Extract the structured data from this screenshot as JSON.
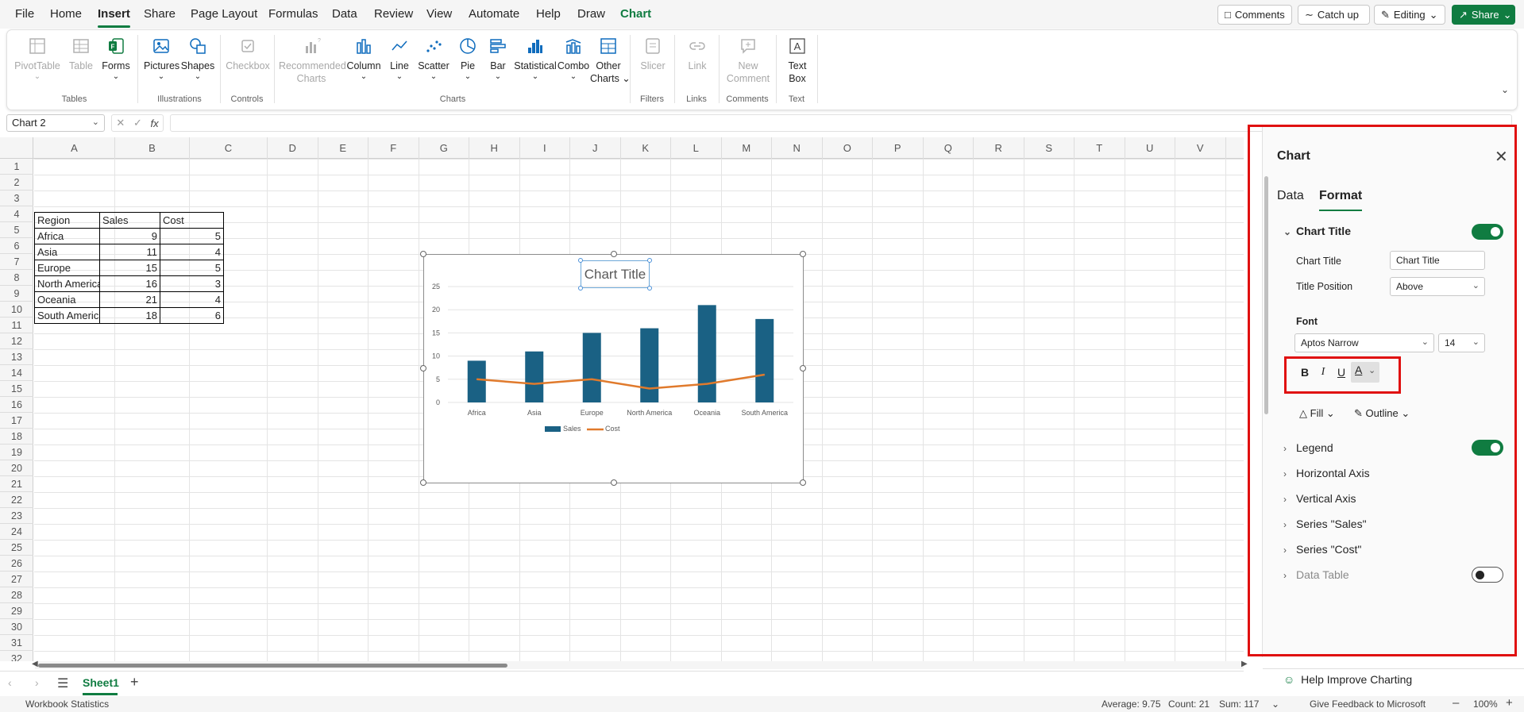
{
  "menu": {
    "tabs": [
      "File",
      "Home",
      "Insert",
      "Share",
      "Page Layout",
      "Formulas",
      "Data",
      "Review",
      "View",
      "Automate",
      "Help",
      "Draw",
      "Chart"
    ],
    "active": "Insert",
    "comments": "Comments",
    "catchup": "Catch up",
    "editing": "Editing",
    "share": "Share"
  },
  "ribbon": {
    "pivottable": "PivotTable",
    "table": "Table",
    "forms": "Forms",
    "pictures": "Pictures",
    "shapes": "Shapes",
    "checkbox": "Checkbox",
    "recommended": "Recommended",
    "charts_word": "Charts",
    "column": "Column",
    "line": "Line",
    "scatter": "Scatter",
    "pie": "Pie",
    "bar": "Bar",
    "statistical": "Statistical",
    "combo": "Combo",
    "other": "Other",
    "other2": "Charts",
    "slicer": "Slicer",
    "link": "Link",
    "new": "New",
    "comment": "Comment",
    "text": "Text",
    "box": "Box",
    "groups": {
      "tables": "Tables",
      "illustrations": "Illustrations",
      "controls": "Controls",
      "charts": "Charts",
      "filters": "Filters",
      "links": "Links",
      "comments": "Comments",
      "text": "Text"
    }
  },
  "formula": {
    "namebox": "Chart 2",
    "fx": "fx"
  },
  "columns": [
    "A",
    "B",
    "C",
    "D",
    "E",
    "F",
    "G",
    "H",
    "I",
    "J",
    "K",
    "L",
    "M",
    "N",
    "O",
    "P",
    "Q",
    "R",
    "S",
    "T",
    "U",
    "V"
  ],
  "rows": [
    "1",
    "2",
    "3",
    "4",
    "5",
    "6",
    "7",
    "8",
    "9",
    "10",
    "11",
    "12",
    "13",
    "14",
    "15",
    "16",
    "17",
    "18",
    "19",
    "20",
    "21",
    "22",
    "23",
    "24",
    "25",
    "26",
    "27",
    "28",
    "29",
    "30",
    "31",
    "32"
  ],
  "table": {
    "headers": [
      "Region",
      "Sales",
      "Cost"
    ],
    "rows": [
      [
        "Africa",
        "9",
        "5"
      ],
      [
        "Asia",
        "11",
        "4"
      ],
      [
        "Europe",
        "15",
        "5"
      ],
      [
        "North America",
        "16",
        "3"
      ],
      [
        "Oceania",
        "21",
        "4"
      ],
      [
        "South America",
        "18",
        "6"
      ]
    ]
  },
  "chart_data": {
    "type": "bar",
    "title": "Chart Title",
    "categories": [
      "Africa",
      "Asia",
      "Europe",
      "North America",
      "Oceania",
      "South America"
    ],
    "series": [
      {
        "name": "Sales",
        "type": "bar",
        "color": "#1a6184",
        "values": [
          9,
          11,
          15,
          16,
          21,
          18
        ]
      },
      {
        "name": "Cost",
        "type": "line",
        "color": "#e07a2c",
        "values": [
          5,
          4,
          5,
          3,
          4,
          6
        ]
      }
    ],
    "ylim": [
      0,
      25
    ],
    "yticks": [
      "0",
      "5",
      "10",
      "15",
      "20",
      "25"
    ],
    "grid": true,
    "legend": "bottom"
  },
  "sheets": {
    "active": "Sheet1"
  },
  "status": {
    "workbook": "Workbook Statistics",
    "average": "Average: 9.75",
    "count": "Count: 21",
    "sum": "Sum: 117",
    "feedback": "Give Feedback to Microsoft",
    "zoom": "100%"
  },
  "panel": {
    "title": "Chart",
    "tabs": [
      "Data",
      "Format"
    ],
    "active_tab": "Format",
    "chart_title_section": "Chart Title",
    "chart_title_label": "Chart Title",
    "chart_title_value": "Chart Title",
    "title_position_label": "Title Position",
    "title_position_value": "Above",
    "font_label": "Font",
    "font_name": "Aptos Narrow",
    "font_size": "14",
    "bold": "B",
    "italic": "I",
    "underline": "U",
    "fontcolor": "A",
    "fill": "Fill",
    "outline": "Outline",
    "sections": [
      "Legend",
      "Horizontal Axis",
      "Vertical Axis",
      "Series \"Sales\"",
      "Series \"Cost\"",
      "Data Table"
    ],
    "help": "Help Improve Charting"
  }
}
